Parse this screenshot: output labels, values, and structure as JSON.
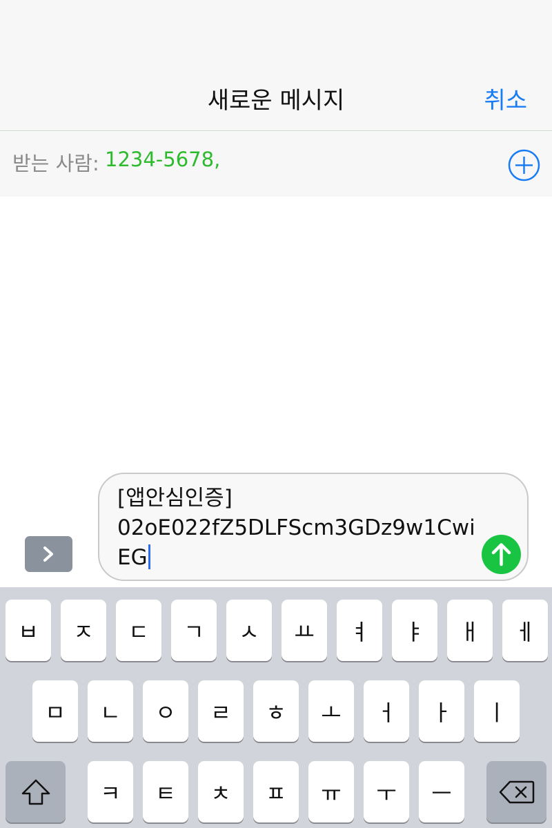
{
  "nav": {
    "title": "새로운 메시지",
    "cancel_label": "취소"
  },
  "recipient": {
    "label": "받는 사람:",
    "value": "1234-5678",
    "separator": ","
  },
  "composer": {
    "line1": "[앱안심인증]",
    "line2": "02oE022fZ5DLFScm3GDz9w1CwiEG"
  },
  "keyboard": {
    "row1": [
      "ㅂ",
      "ㅈ",
      "ㄷ",
      "ㄱ",
      "ㅅ",
      "ㅛ",
      "ㅕ",
      "ㅑ",
      "ㅐ",
      "ㅔ"
    ],
    "row2": [
      "ㅁ",
      "ㄴ",
      "ㅇ",
      "ㄹ",
      "ㅎ",
      "ㅗ",
      "ㅓ",
      "ㅏ",
      "ㅣ"
    ],
    "row3": [
      "ㅋ",
      "ㅌ",
      "ㅊ",
      "ㅍ",
      "ㅠ",
      "ㅜ",
      "ㅡ"
    ]
  },
  "icons": {
    "add": "add-recipient-icon",
    "expand": "chevron-right-icon",
    "send": "arrow-up-icon",
    "shift": "shift-icon",
    "delete": "delete-backspace-icon"
  },
  "colors": {
    "accent_blue": "#1a7cf5",
    "recipient_green": "#2dbb2d",
    "send_green": "#19c443",
    "keyboard_bg": "#d1d4db"
  }
}
